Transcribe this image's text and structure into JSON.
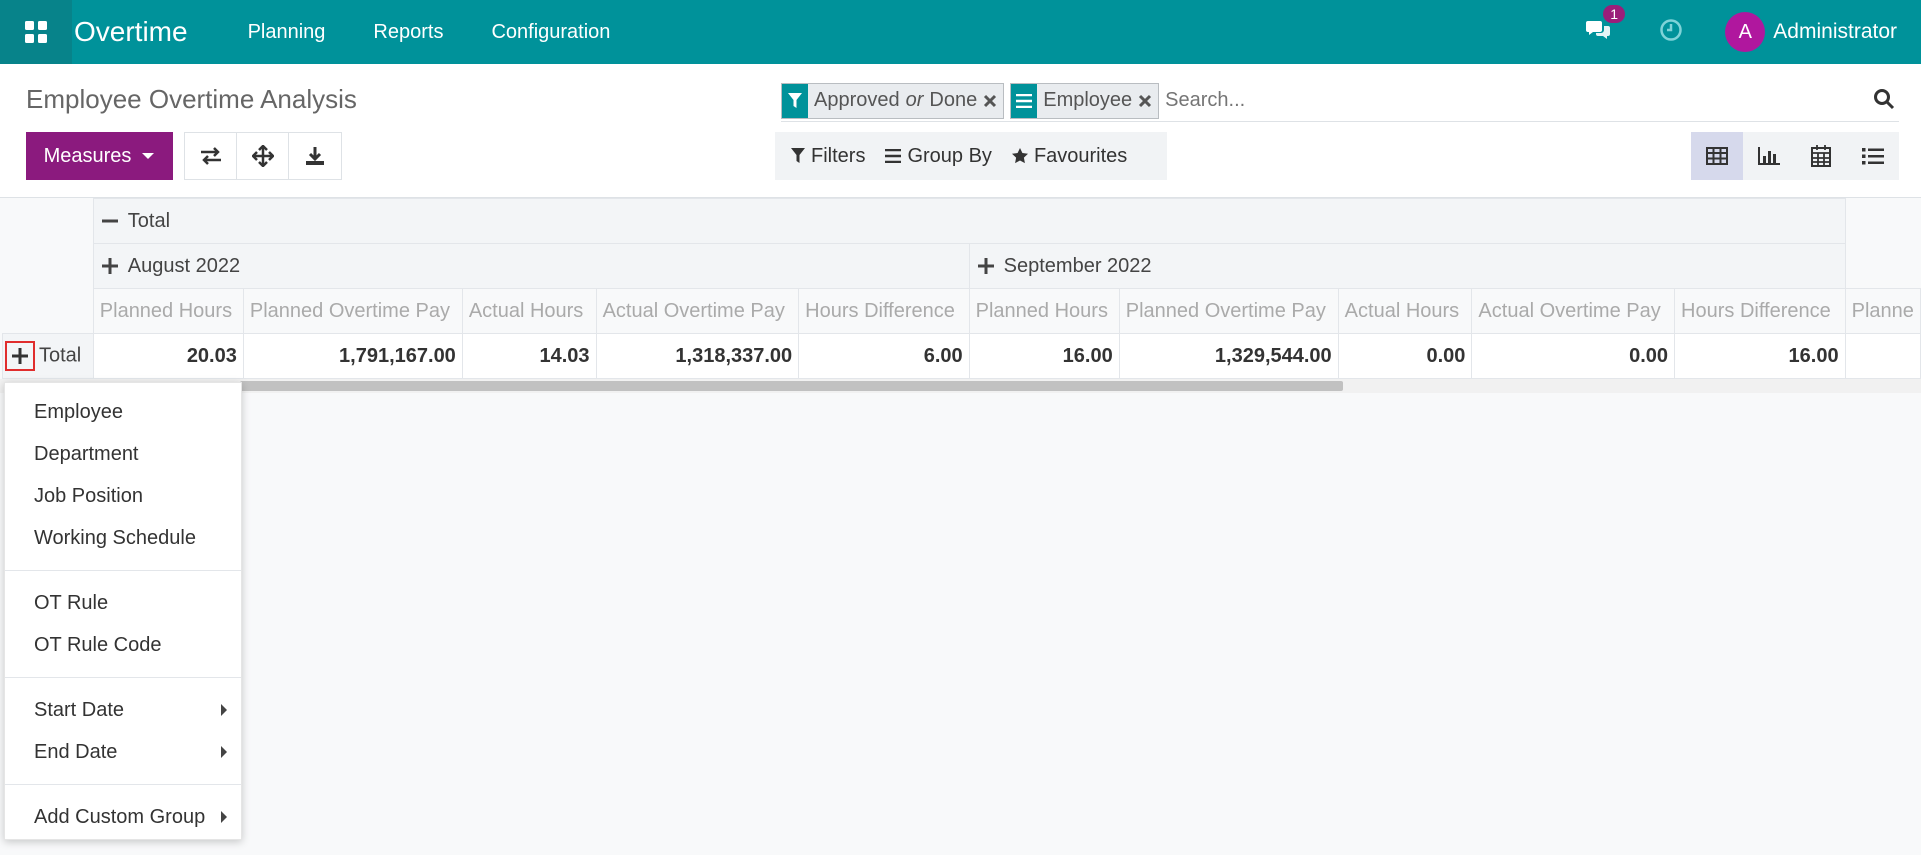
{
  "navbar": {
    "app_name": "Overtime",
    "menu": [
      "Planning",
      "Reports",
      "Configuration"
    ],
    "chat_count": "1",
    "avatar_letter": "A",
    "user": "Administrator"
  },
  "control_panel": {
    "title": "Employee Overtime Analysis",
    "measures_label": "Measures",
    "facets": {
      "status_part1": "Approved",
      "status_or": "or",
      "status_part2": "Done",
      "groupby": "Employee"
    },
    "search_placeholder": "Search...",
    "filters_label": "Filters",
    "groupby_label": "Group By",
    "favourites_label": "Favourites"
  },
  "pivot": {
    "total_col_label": "Total",
    "months": [
      "August 2022",
      "September 2022"
    ],
    "measures": [
      "Planned Hours",
      "Planned Overtime Pay",
      "Actual Hours",
      "Actual Overtime Pay",
      "Hours Difference"
    ],
    "partial_measure": "Planne",
    "row_label": "Total",
    "august": [
      "20.03",
      "1,791,167.00",
      "14.03",
      "1,318,337.00",
      "6.00"
    ],
    "september": [
      "16.00",
      "1,329,544.00",
      "0.00",
      "0.00",
      "16.00"
    ]
  },
  "dropdown": {
    "items": [
      "Employee",
      "Department",
      "Job Position",
      "Working Schedule",
      "OT Rule",
      "OT Rule Code",
      "Start Date",
      "End Date",
      "Add Custom Group"
    ]
  },
  "colors": {
    "navbar": "#00929a",
    "measures_button": "#8b1a7e",
    "badge": "#9a1e7a",
    "avatar": "#b0179e"
  }
}
